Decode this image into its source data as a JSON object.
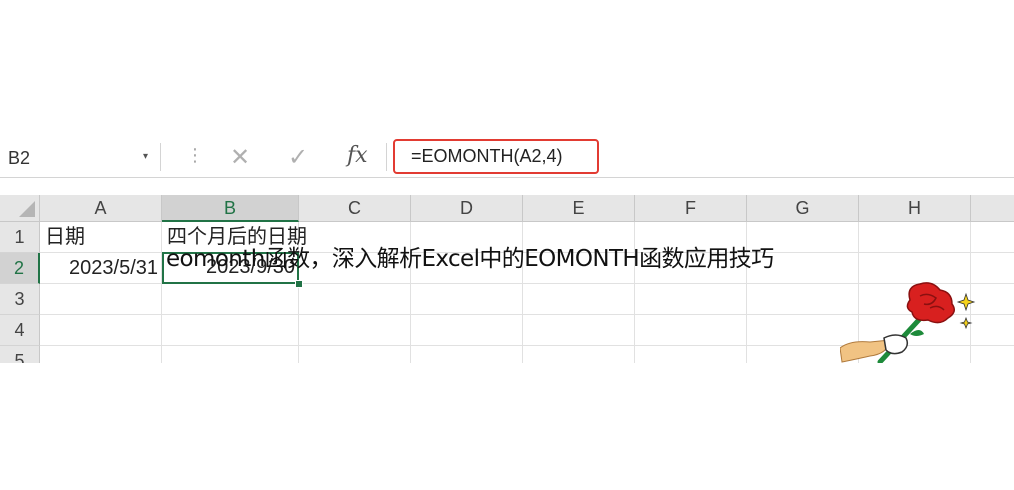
{
  "formula_bar": {
    "name_box": "B2",
    "name_box_dropdown": "▾",
    "separator": "⋮",
    "cancel_glyph": "✕",
    "enter_glyph": "✓",
    "fx_label": "fx",
    "formula": "=EOMONTH(A2,4)",
    "highlight_color": "#e23b32"
  },
  "columns": [
    "A",
    "B",
    "C",
    "D",
    "E",
    "F",
    "G",
    "H"
  ],
  "selected_column": "B",
  "rows": [
    "1",
    "2",
    "3",
    "4",
    "5"
  ],
  "selected_row": "2",
  "cells": {
    "A1": "日期",
    "B1": "四个月后的日期",
    "A2": "2023/5/31",
    "B2": "2023/9/30"
  },
  "overlay_caption": "eomonth函数，深入解析Excel中的EOMONTH函数应用技巧",
  "sticker": {
    "icon": "hand-holding-rose-icon"
  },
  "colors": {
    "excel_green": "#217346",
    "header_bg": "#e6e6e6"
  }
}
